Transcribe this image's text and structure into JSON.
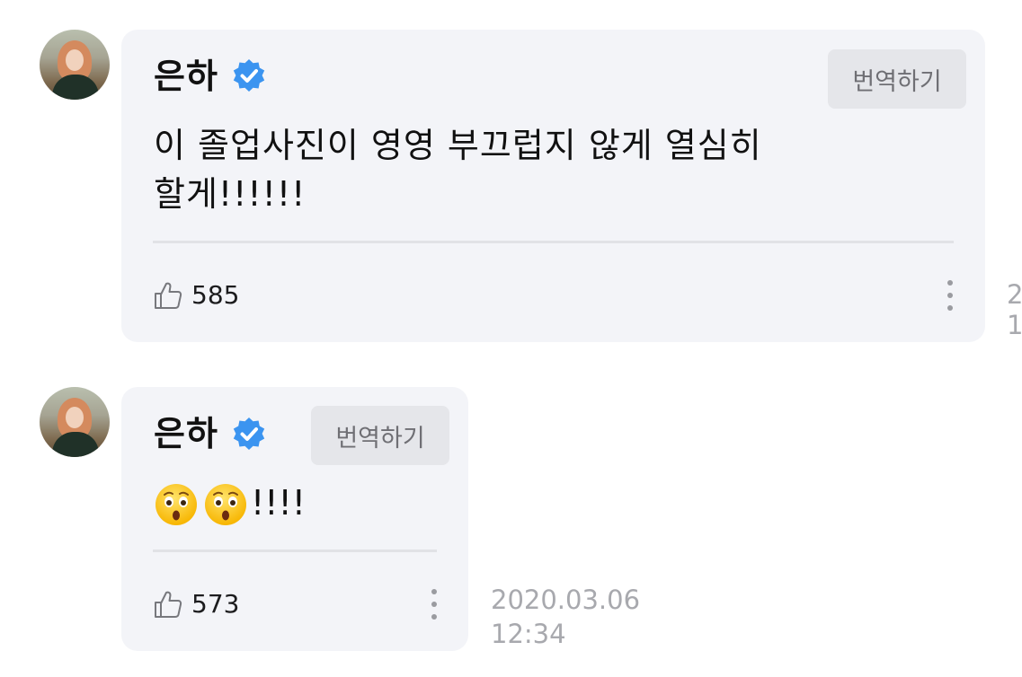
{
  "comments": [
    {
      "author": "은하",
      "verified": true,
      "translate_label": "번역하기",
      "text_line1": "이 졸업사진이 영영 부끄럽지 않게 열심히",
      "text_line2": "할게!!!!!!",
      "likes": "585",
      "timestamp_line1": "2",
      "timestamp_line2": "1"
    },
    {
      "author": "은하",
      "verified": true,
      "translate_label": "번역하기",
      "emojis": [
        "hushed-face-emoji",
        "hushed-face-emoji"
      ],
      "text_suffix": "!!!!",
      "likes": "573",
      "timestamp_line1": "2020.03.06",
      "timestamp_line2": "12:34"
    }
  ],
  "colors": {
    "bubble": "#f3f4f8",
    "verified_badge": "#3b94f0",
    "timestamp": "#a8a9ae"
  },
  "icons": [
    "avatar",
    "verified-badge-icon",
    "thumbs-up-icon",
    "more-vertical-icon"
  ]
}
